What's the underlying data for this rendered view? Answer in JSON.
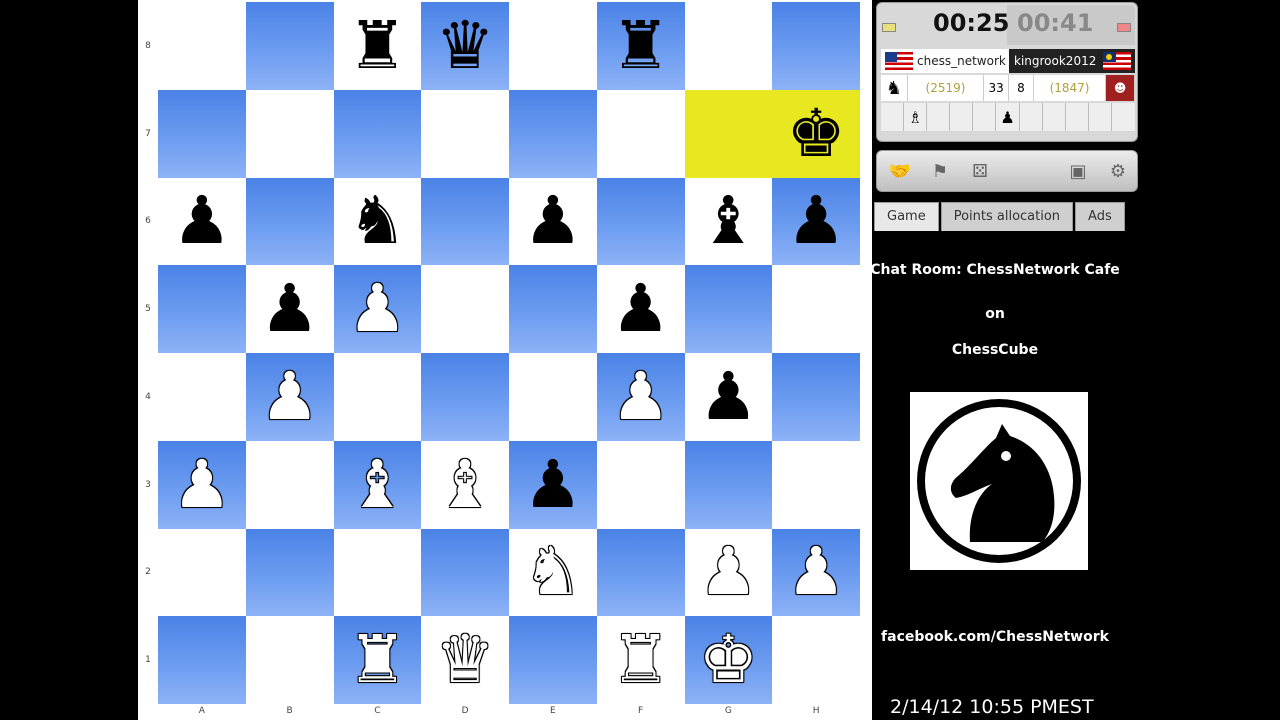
{
  "board": {
    "ranks": [
      "8",
      "7",
      "6",
      "5",
      "4",
      "3",
      "2",
      "1"
    ],
    "files": [
      "A",
      "B",
      "C",
      "D",
      "E",
      "F",
      "G",
      "H"
    ],
    "highlight": [
      "g7",
      "h7"
    ],
    "pieces": {
      "c8": {
        "color": "b",
        "type": "rook"
      },
      "d8": {
        "color": "b",
        "type": "queen"
      },
      "f8": {
        "color": "b",
        "type": "rook"
      },
      "h7": {
        "color": "b",
        "type": "king"
      },
      "a6": {
        "color": "b",
        "type": "pawn"
      },
      "c6": {
        "color": "b",
        "type": "knight"
      },
      "e6": {
        "color": "b",
        "type": "pawn"
      },
      "g6": {
        "color": "b",
        "type": "bishop"
      },
      "h6": {
        "color": "b",
        "type": "pawn"
      },
      "b5": {
        "color": "b",
        "type": "pawn"
      },
      "c5": {
        "color": "w",
        "type": "pawn"
      },
      "f5": {
        "color": "b",
        "type": "pawn"
      },
      "b4": {
        "color": "w",
        "type": "pawn"
      },
      "f4": {
        "color": "w",
        "type": "pawn"
      },
      "g4": {
        "color": "b",
        "type": "pawn"
      },
      "a3": {
        "color": "w",
        "type": "pawn"
      },
      "c3": {
        "color": "w",
        "type": "bishop"
      },
      "d3": {
        "color": "w",
        "type": "bishop"
      },
      "e3": {
        "color": "b",
        "type": "pawn"
      },
      "e2": {
        "color": "w",
        "type": "knight"
      },
      "g2": {
        "color": "w",
        "type": "pawn"
      },
      "h2": {
        "color": "w",
        "type": "pawn"
      },
      "c1": {
        "color": "w",
        "type": "rook"
      },
      "d1": {
        "color": "w",
        "type": "queen"
      },
      "f1": {
        "color": "w",
        "type": "rook"
      },
      "g1": {
        "color": "w",
        "type": "king"
      }
    }
  },
  "clock": {
    "left": "00:25",
    "right": "00:41"
  },
  "players": {
    "p1": {
      "name": "chess_network",
      "rating": "(2519)",
      "score": "33",
      "flag": "us-flag-icon"
    },
    "p2": {
      "name": "kingrook2012",
      "rating": "(1847)",
      "score": "8",
      "flag": "malaysia-flag-icon"
    }
  },
  "captured": {
    "p1": "♗",
    "p2": "♟"
  },
  "tabs": [
    "Game",
    "Points allocation",
    "Ads"
  ],
  "info": {
    "chat_room": "Chat Room: ChessNetwork Cafe",
    "on": "on",
    "site": "ChessCube",
    "facebook": "facebook.com/ChessNetwork",
    "datetime": "2/14/12 10:55 PMEST"
  },
  "colors": {
    "dark_square": "#5a8ee9",
    "light_square": "#ffffff",
    "highlight": "#e8e820"
  }
}
